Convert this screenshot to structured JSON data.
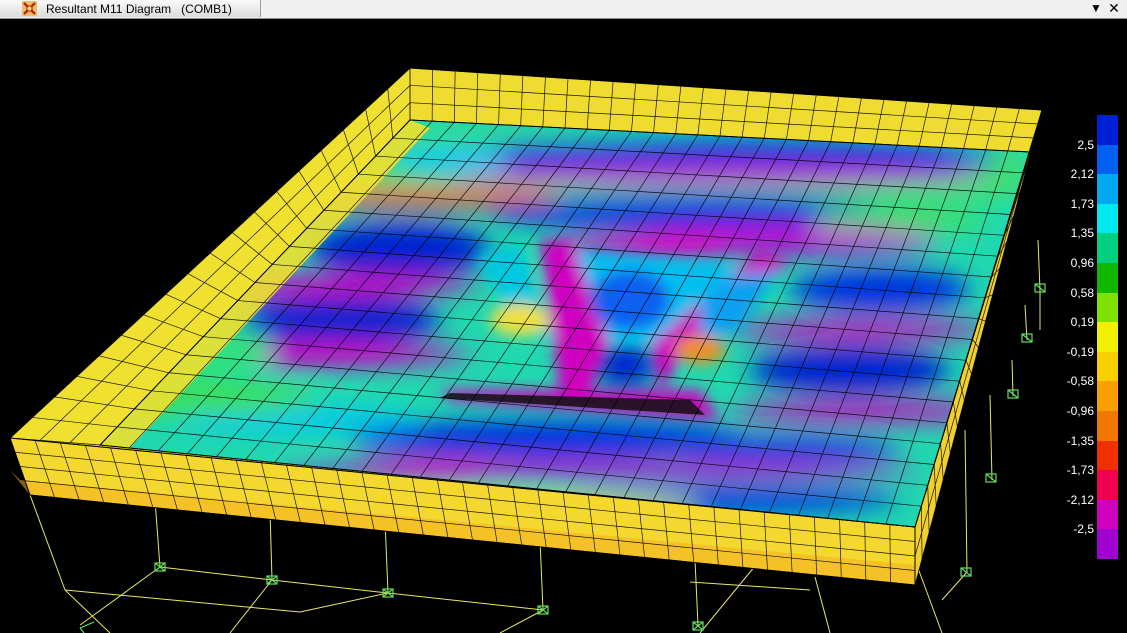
{
  "window": {
    "title": "Resultant M11 Diagram   (COMB1)",
    "dropdown_icon": "chevron-down-icon",
    "close_icon": "close-icon",
    "app_icon": "sap-app-icon"
  },
  "legend": {
    "labels": [
      "2,5",
      "2,12",
      "1,73",
      "1,35",
      "0,96",
      "0,58",
      "0,19",
      "-0,19",
      "-0,58",
      "-0,96",
      "-1,35",
      "-1,73",
      "-2,12",
      "-2,5"
    ],
    "colors": [
      "#0020d8",
      "#0060f0",
      "#00a8f0",
      "#00e8f0",
      "#00d080",
      "#10b800",
      "#80e000",
      "#f0f000",
      "#f8d000",
      "#f8a000",
      "#f07800",
      "#f03000",
      "#f00050",
      "#d000c0",
      "#a000d0"
    ]
  },
  "viewport": {
    "background": "#000000",
    "frame_color": "#f0f060",
    "support_color": "#60f060"
  }
}
